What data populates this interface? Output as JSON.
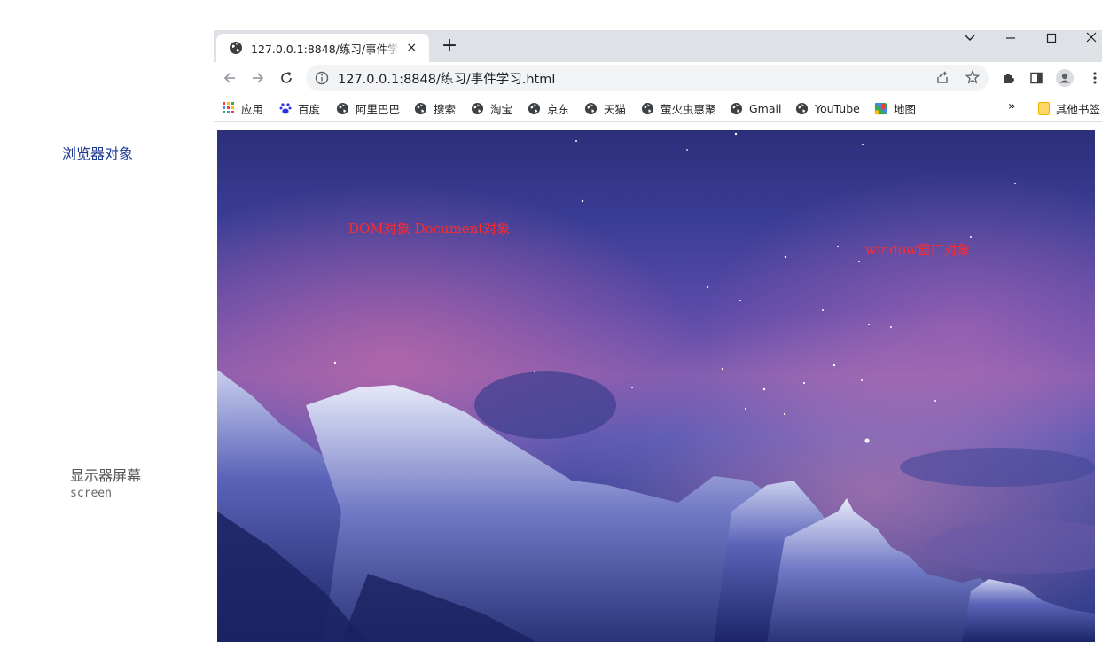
{
  "annotations": {
    "browser_object": "浏览器对象",
    "screen_object": "显示器屏幕",
    "screen_code": "screen"
  },
  "tab": {
    "title": "127.0.0.1:8848/练习/事件学习.html",
    "close": "×",
    "new_tab": "+"
  },
  "window_controls": {
    "tab_search": "⌄",
    "minimize": "—",
    "maximize": "☐",
    "close": "✕"
  },
  "address_bar": {
    "url": "127.0.0.1:8848/练习/事件学习.html"
  },
  "bookmarks": {
    "items": [
      {
        "label": "应用",
        "icon": "apps-grid-icon"
      },
      {
        "label": "百度",
        "icon": "baidu-paw-icon"
      },
      {
        "label": "阿里巴巴",
        "icon": "globe-icon"
      },
      {
        "label": "搜索",
        "icon": "globe-icon"
      },
      {
        "label": "淘宝",
        "icon": "globe-icon"
      },
      {
        "label": "京东",
        "icon": "globe-icon"
      },
      {
        "label": "天猫",
        "icon": "globe-icon"
      },
      {
        "label": "萤火虫惠聚",
        "icon": "globe-icon"
      },
      {
        "label": "Gmail",
        "icon": "globe-icon"
      },
      {
        "label": "YouTube",
        "icon": "globe-icon"
      },
      {
        "label": "地图",
        "icon": "maps-icon"
      }
    ],
    "overflow": "»",
    "other": "其他书签"
  },
  "page": {
    "dom_label": "DOM对象 Document对象",
    "window_label": "window窗口对象"
  },
  "colors": {
    "annotation_blue": "#1f3a93",
    "overlay_red": "#ff2a2a",
    "tabstrip": "#dee1e6",
    "omnibox": "#f1f3f4"
  }
}
